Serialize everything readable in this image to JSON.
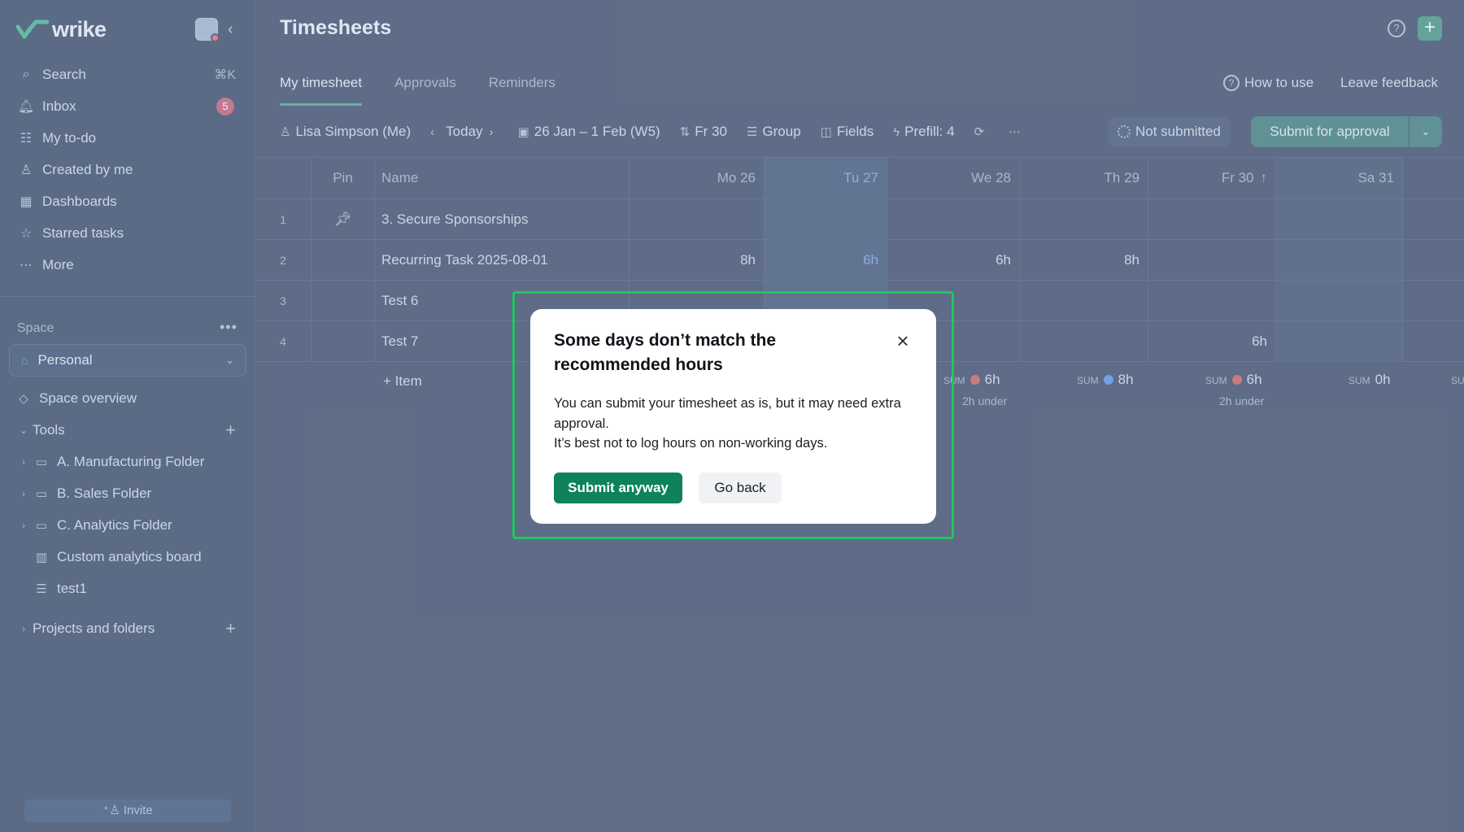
{
  "sidebar": {
    "logo_text": "wrike",
    "nav": [
      {
        "label": "Search",
        "shortcut": "⌘K"
      },
      {
        "label": "Inbox",
        "badge": "5"
      },
      {
        "label": "My to-do"
      },
      {
        "label": "Created by me"
      },
      {
        "label": "Dashboards"
      },
      {
        "label": "Starred tasks"
      },
      {
        "label": "More"
      }
    ],
    "space_label": "Space",
    "space_selected": "Personal",
    "space_overview": "Space overview",
    "tools_label": "Tools",
    "tree": [
      {
        "label": "A. Manufacturing Folder"
      },
      {
        "label": "B. Sales Folder"
      },
      {
        "label": "C. Analytics Folder"
      },
      {
        "label": "Custom analytics board"
      },
      {
        "label": "test1"
      }
    ],
    "projects_label": "Projects and folders",
    "invite_label": "Invite"
  },
  "header": {
    "title": "Timesheets",
    "tabs": [
      {
        "label": "My timesheet",
        "active": true
      },
      {
        "label": "Approvals"
      },
      {
        "label": "Reminders"
      }
    ],
    "how_to_use": "How to use",
    "leave_feedback": "Leave feedback"
  },
  "toolbar": {
    "user": "Lisa Simpson (Me)",
    "today": "Today",
    "date_range": "26 Jan – 1 Feb (W5)",
    "sort": "Fr 30",
    "group": "Group",
    "fields": "Fields",
    "prefill": "Prefill: 4",
    "status": "Not submitted",
    "submit_label": "Submit for approval"
  },
  "grid": {
    "headers": {
      "pin": "Pin",
      "name": "Name",
      "days": [
        "Mo 26",
        "Tu 27",
        "We 28",
        "Th 29",
        "Fr 30",
        "Sa 31"
      ]
    },
    "rows": [
      {
        "num": "1",
        "name": "3. Secure Sponsorships",
        "pinned": true,
        "hours": [
          "",
          "",
          "",
          "",
          "",
          ""
        ]
      },
      {
        "num": "2",
        "name": "Recurring Task 2025-08-01",
        "pinned": false,
        "hours": [
          "8h",
          "6h",
          "6h",
          "8h",
          "",
          ""
        ]
      },
      {
        "num": "3",
        "name": "Test 6",
        "pinned": false,
        "hours": [
          "",
          "",
          "",
          "",
          "",
          ""
        ]
      },
      {
        "num": "4",
        "name": "Test 7",
        "pinned": false,
        "hours": [
          "",
          "",
          "",
          "",
          "6h",
          ""
        ]
      }
    ],
    "add_item": "Item",
    "sums": {
      "we": {
        "label": "SUM",
        "value": "6h",
        "note": "2h under",
        "status_color": "#c0392b"
      },
      "th": {
        "label": "SUM",
        "value": "8h",
        "status_color": "#2b7bd6"
      },
      "fr": {
        "label": "SUM",
        "value": "6h",
        "note": "2h under",
        "status_color": "#c0392b"
      },
      "sa": {
        "label": "SUM",
        "value": "0h"
      },
      "su": {
        "label": "SU"
      }
    }
  },
  "dialog": {
    "title": "Some days don’t match the recommended hours",
    "body_line1": "You can submit your timesheet as is, but it may need extra approval.",
    "body_line2": "It’s best not to log hours on non-working days.",
    "submit_anyway": "Submit anyway",
    "go_back": "Go back"
  }
}
